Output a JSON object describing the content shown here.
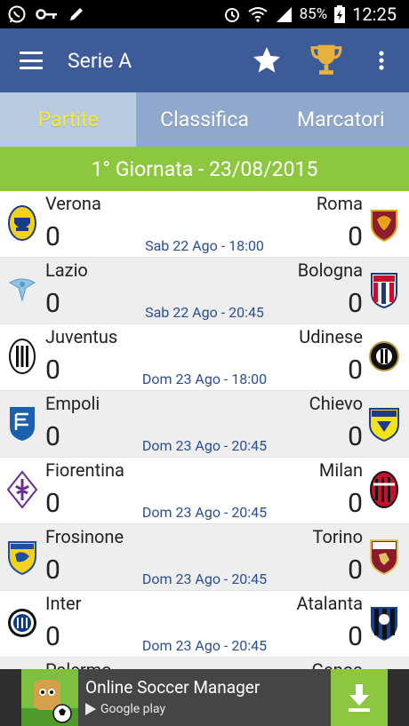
{
  "status_bar": {
    "battery": "85%",
    "time": "12:25"
  },
  "app_bar": {
    "title": "Serie A"
  },
  "tabs": [
    {
      "label": "Partite",
      "active": true
    },
    {
      "label": "Classifica",
      "active": false
    },
    {
      "label": "Marcatori",
      "active": false
    }
  ],
  "round": {
    "title": "1° Giornata - 23/08/2015"
  },
  "matches": [
    {
      "home": "Verona",
      "away": "Roma",
      "home_score": "0",
      "away_score": "0",
      "date": "Sab 22 Ago - 18:00"
    },
    {
      "home": "Lazio",
      "away": "Bologna",
      "home_score": "0",
      "away_score": "0",
      "date": "Sab 22 Ago - 20:45"
    },
    {
      "home": "Juventus",
      "away": "Udinese",
      "home_score": "0",
      "away_score": "0",
      "date": "Dom 23 Ago - 18:00"
    },
    {
      "home": "Empoli",
      "away": "Chievo",
      "home_score": "0",
      "away_score": "0",
      "date": "Dom 23 Ago - 20:45"
    },
    {
      "home": "Fiorentina",
      "away": "Milan",
      "home_score": "0",
      "away_score": "0",
      "date": "Dom 23 Ago - 20:45"
    },
    {
      "home": "Frosinone",
      "away": "Torino",
      "home_score": "0",
      "away_score": "0",
      "date": "Dom 23 Ago - 20:45"
    },
    {
      "home": "Inter",
      "away": "Atalanta",
      "home_score": "0",
      "away_score": "0",
      "date": "Dom 23 Ago - 20:45"
    },
    {
      "home": "Palermo",
      "away": "Genoa",
      "home_score": "",
      "away_score": "",
      "date": ""
    }
  ],
  "ad": {
    "title": "Online Soccer Manager",
    "store": "Google play"
  },
  "colors": {
    "app_bar": "#3d5a99",
    "tabs": "#8fa8cc",
    "tab_active": "#b9cbe0",
    "tab_active_text": "#f5ea38",
    "round_bar": "#8dc63f",
    "date_text": "#2a4f96",
    "trophy": "#e8b23a"
  },
  "icons": {
    "menu": "menu-icon",
    "favorite": "star-icon",
    "trophy": "trophy-icon",
    "overflow": "more-vert-icon",
    "download": "download-icon"
  }
}
